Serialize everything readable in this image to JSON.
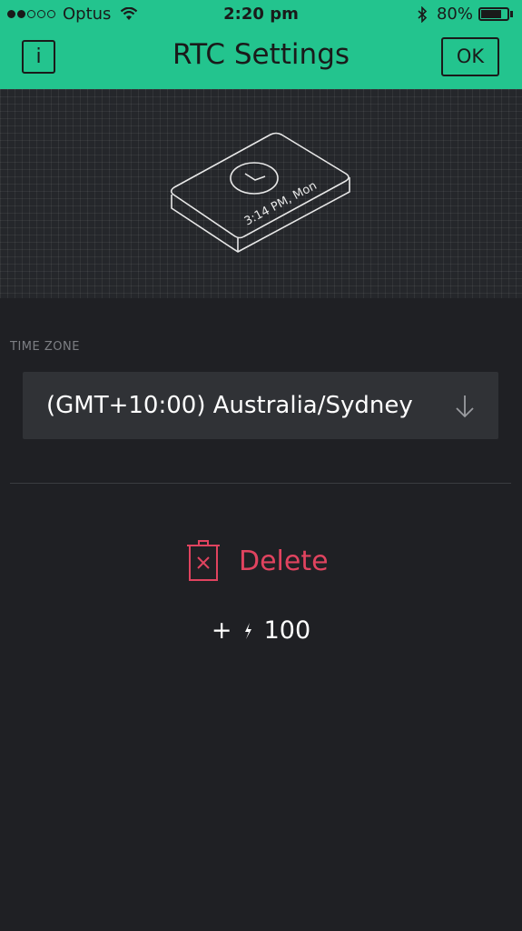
{
  "status_bar": {
    "signal_dots": [
      true,
      true,
      false,
      false,
      false
    ],
    "carrier": "Optus",
    "time": "2:20 pm",
    "battery_percent": "80%",
    "battery_level": 0.8
  },
  "header": {
    "title": "RTC Settings",
    "info_label": "i",
    "ok_label": "OK",
    "background_color": "#23c48e"
  },
  "hero": {
    "device_text": "3:14 PM, Mon",
    "icons": [
      "rtc-device-icon",
      "clock-icon"
    ]
  },
  "time_zone": {
    "label": "TIME ZONE",
    "value": "(GMT+10:00) Australia/Sydney",
    "arrow_icon": "arrow-down-icon"
  },
  "actions": {
    "delete_label": "Delete",
    "delete_icon": "trash-icon",
    "delete_color": "#e0435f",
    "energy_plus": "+",
    "energy_icon": "lightning-bolt-icon",
    "energy_value": "100"
  }
}
